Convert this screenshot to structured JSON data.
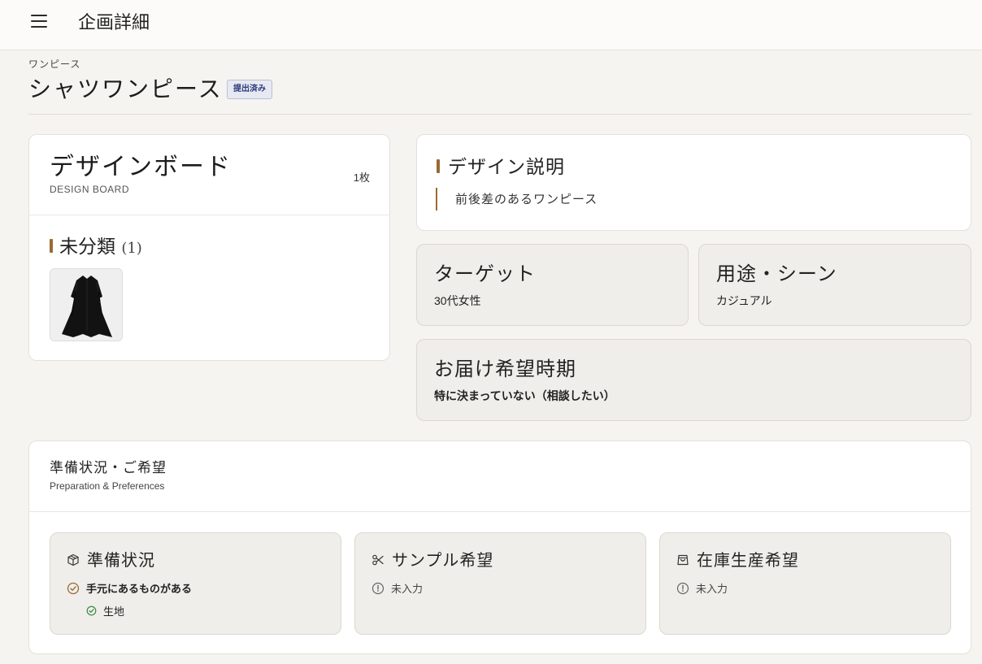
{
  "header": {
    "title": "企画詳細"
  },
  "page": {
    "category": "ワンピース",
    "title": "シャツワンピース",
    "status": "提出済み"
  },
  "design_board": {
    "title": "デザインボード",
    "subtitle": "DESIGN BOARD",
    "count": "1枚",
    "category_name": "未分類",
    "category_count": "(1)",
    "thumbnail_icon": "black-shirt-dress-image"
  },
  "design_description": {
    "title": "デザイン説明",
    "text": "前後差のあるワンピース"
  },
  "target": {
    "title": "ターゲット",
    "value": "30代女性"
  },
  "usage": {
    "title": "用途・シーン",
    "value": "カジュアル"
  },
  "delivery": {
    "title": "お届け希望時期",
    "value": "特に決まっていない（相談したい）"
  },
  "preparation": {
    "title": "準備状況・ご希望",
    "subtitle": "Preparation & Preferences",
    "items": [
      {
        "title": "準備状況",
        "icon": "box-icon",
        "status": "手元にあるものがある",
        "sub_items": [
          "生地"
        ]
      },
      {
        "title": "サンプル希望",
        "icon": "scissors-icon",
        "status": "未入力"
      },
      {
        "title": "在庫生産希望",
        "icon": "shopping-bag-icon",
        "status": "未入力"
      }
    ]
  },
  "colors": {
    "accent": "#9a6a32",
    "success": "#3a8a45",
    "badge_bg": "#e7e9f2",
    "badge_text": "#2d3b7a"
  }
}
